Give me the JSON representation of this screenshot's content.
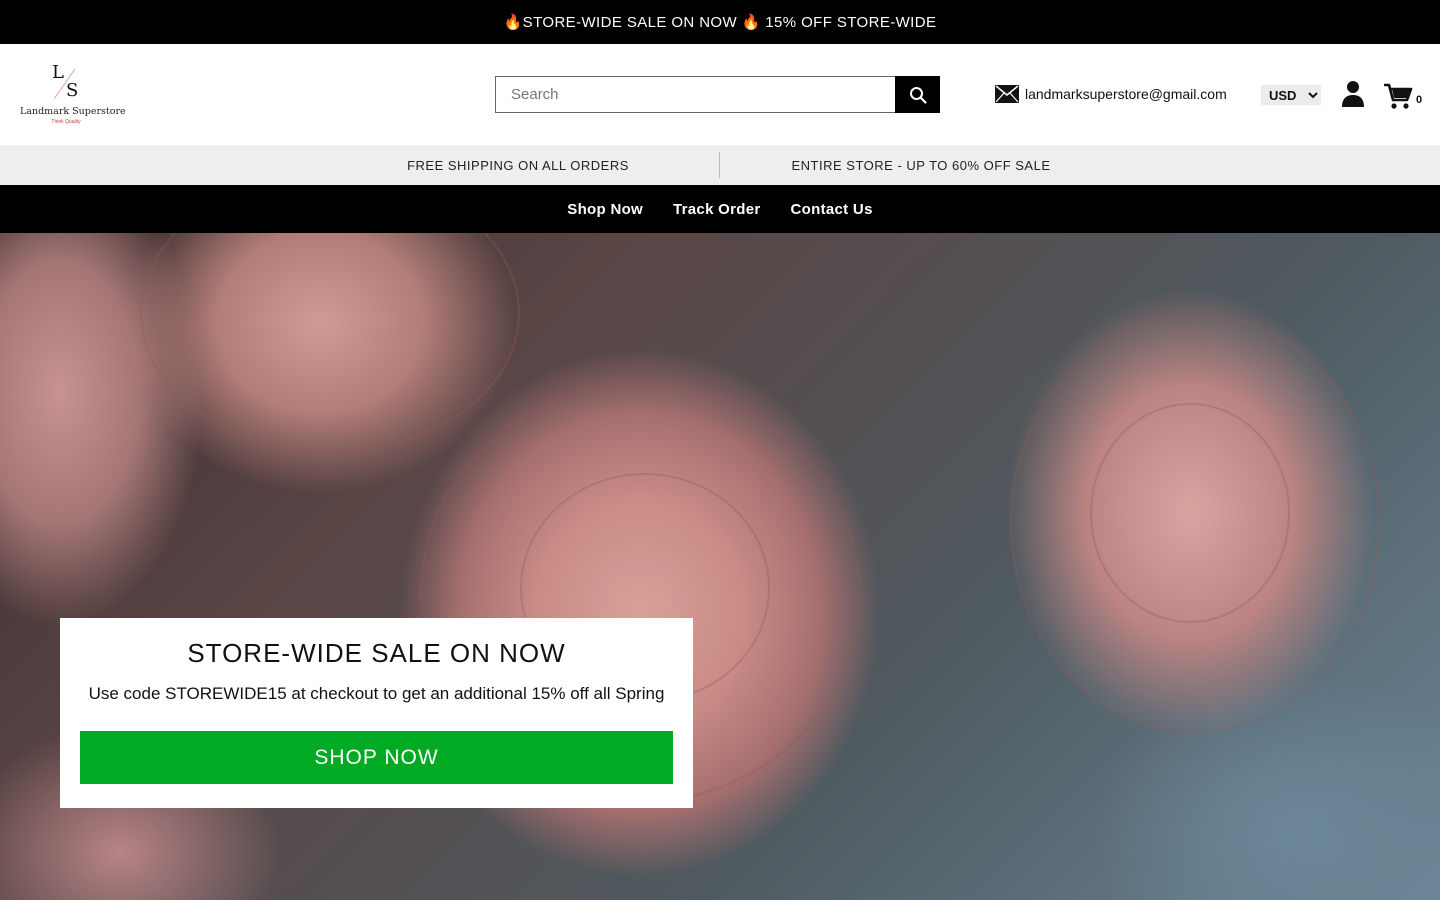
{
  "announcement": {
    "text": "🔥STORE-WIDE SALE ON NOW 🔥 15% OFF STORE-WIDE"
  },
  "header": {
    "logo": {
      "top": "L",
      "bottom": "S",
      "brand": "Landmark Superstore",
      "tagline": "Think Quality"
    },
    "search": {
      "placeholder": "Search",
      "value": ""
    },
    "email": "landmarksuperstore@gmail.com",
    "currency": {
      "selected": "USD"
    },
    "cart": {
      "count": "0"
    }
  },
  "promo_bar": {
    "left": "FREE SHIPPING ON ALL ORDERS",
    "right": "ENTIRE STORE - UP TO 60% OFF SALE"
  },
  "nav": {
    "items": [
      {
        "label": "Shop Now"
      },
      {
        "label": "Track Order"
      },
      {
        "label": "Contact Us"
      }
    ]
  },
  "hero": {
    "title": "STORE-WIDE SALE ON NOW",
    "subtitle": "Use code STOREWIDE15 at checkout to get an additional 15% off all Spring",
    "button": "SHOP NOW",
    "button_color": "#00aa22"
  }
}
